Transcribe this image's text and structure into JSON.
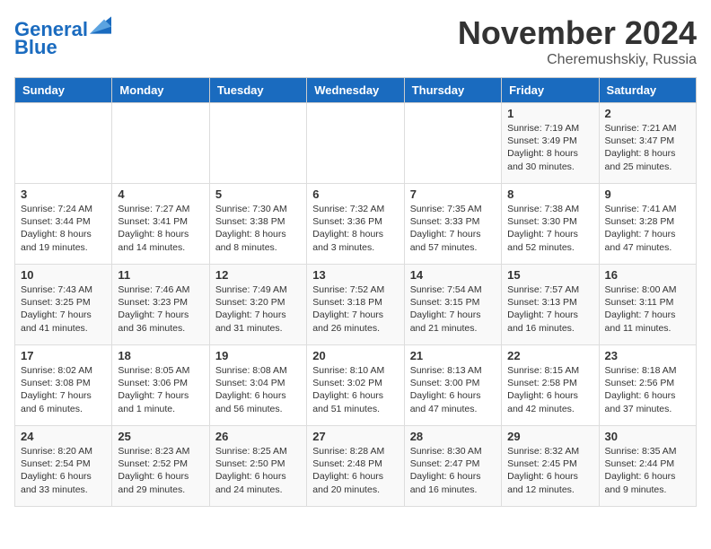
{
  "logo": {
    "line1": "General",
    "line2": "Blue"
  },
  "title": {
    "month": "November 2024",
    "location": "Cheremushskiy, Russia"
  },
  "headers": [
    "Sunday",
    "Monday",
    "Tuesday",
    "Wednesday",
    "Thursday",
    "Friday",
    "Saturday"
  ],
  "rows": [
    [
      {
        "day": "",
        "info": ""
      },
      {
        "day": "",
        "info": ""
      },
      {
        "day": "",
        "info": ""
      },
      {
        "day": "",
        "info": ""
      },
      {
        "day": "",
        "info": ""
      },
      {
        "day": "1",
        "info": "Sunrise: 7:19 AM\nSunset: 3:49 PM\nDaylight: 8 hours and 30 minutes."
      },
      {
        "day": "2",
        "info": "Sunrise: 7:21 AM\nSunset: 3:47 PM\nDaylight: 8 hours and 25 minutes."
      }
    ],
    [
      {
        "day": "3",
        "info": "Sunrise: 7:24 AM\nSunset: 3:44 PM\nDaylight: 8 hours and 19 minutes."
      },
      {
        "day": "4",
        "info": "Sunrise: 7:27 AM\nSunset: 3:41 PM\nDaylight: 8 hours and 14 minutes."
      },
      {
        "day": "5",
        "info": "Sunrise: 7:30 AM\nSunset: 3:38 PM\nDaylight: 8 hours and 8 minutes."
      },
      {
        "day": "6",
        "info": "Sunrise: 7:32 AM\nSunset: 3:36 PM\nDaylight: 8 hours and 3 minutes."
      },
      {
        "day": "7",
        "info": "Sunrise: 7:35 AM\nSunset: 3:33 PM\nDaylight: 7 hours and 57 minutes."
      },
      {
        "day": "8",
        "info": "Sunrise: 7:38 AM\nSunset: 3:30 PM\nDaylight: 7 hours and 52 minutes."
      },
      {
        "day": "9",
        "info": "Sunrise: 7:41 AM\nSunset: 3:28 PM\nDaylight: 7 hours and 47 minutes."
      }
    ],
    [
      {
        "day": "10",
        "info": "Sunrise: 7:43 AM\nSunset: 3:25 PM\nDaylight: 7 hours and 41 minutes."
      },
      {
        "day": "11",
        "info": "Sunrise: 7:46 AM\nSunset: 3:23 PM\nDaylight: 7 hours and 36 minutes."
      },
      {
        "day": "12",
        "info": "Sunrise: 7:49 AM\nSunset: 3:20 PM\nDaylight: 7 hours and 31 minutes."
      },
      {
        "day": "13",
        "info": "Sunrise: 7:52 AM\nSunset: 3:18 PM\nDaylight: 7 hours and 26 minutes."
      },
      {
        "day": "14",
        "info": "Sunrise: 7:54 AM\nSunset: 3:15 PM\nDaylight: 7 hours and 21 minutes."
      },
      {
        "day": "15",
        "info": "Sunrise: 7:57 AM\nSunset: 3:13 PM\nDaylight: 7 hours and 16 minutes."
      },
      {
        "day": "16",
        "info": "Sunrise: 8:00 AM\nSunset: 3:11 PM\nDaylight: 7 hours and 11 minutes."
      }
    ],
    [
      {
        "day": "17",
        "info": "Sunrise: 8:02 AM\nSunset: 3:08 PM\nDaylight: 7 hours and 6 minutes."
      },
      {
        "day": "18",
        "info": "Sunrise: 8:05 AM\nSunset: 3:06 PM\nDaylight: 7 hours and 1 minute."
      },
      {
        "day": "19",
        "info": "Sunrise: 8:08 AM\nSunset: 3:04 PM\nDaylight: 6 hours and 56 minutes."
      },
      {
        "day": "20",
        "info": "Sunrise: 8:10 AM\nSunset: 3:02 PM\nDaylight: 6 hours and 51 minutes."
      },
      {
        "day": "21",
        "info": "Sunrise: 8:13 AM\nSunset: 3:00 PM\nDaylight: 6 hours and 47 minutes."
      },
      {
        "day": "22",
        "info": "Sunrise: 8:15 AM\nSunset: 2:58 PM\nDaylight: 6 hours and 42 minutes."
      },
      {
        "day": "23",
        "info": "Sunrise: 8:18 AM\nSunset: 2:56 PM\nDaylight: 6 hours and 37 minutes."
      }
    ],
    [
      {
        "day": "24",
        "info": "Sunrise: 8:20 AM\nSunset: 2:54 PM\nDaylight: 6 hours and 33 minutes."
      },
      {
        "day": "25",
        "info": "Sunrise: 8:23 AM\nSunset: 2:52 PM\nDaylight: 6 hours and 29 minutes."
      },
      {
        "day": "26",
        "info": "Sunrise: 8:25 AM\nSunset: 2:50 PM\nDaylight: 6 hours and 24 minutes."
      },
      {
        "day": "27",
        "info": "Sunrise: 8:28 AM\nSunset: 2:48 PM\nDaylight: 6 hours and 20 minutes."
      },
      {
        "day": "28",
        "info": "Sunrise: 8:30 AM\nSunset: 2:47 PM\nDaylight: 6 hours and 16 minutes."
      },
      {
        "day": "29",
        "info": "Sunrise: 8:32 AM\nSunset: 2:45 PM\nDaylight: 6 hours and 12 minutes."
      },
      {
        "day": "30",
        "info": "Sunrise: 8:35 AM\nSunset: 2:44 PM\nDaylight: 6 hours and 9 minutes."
      }
    ]
  ]
}
